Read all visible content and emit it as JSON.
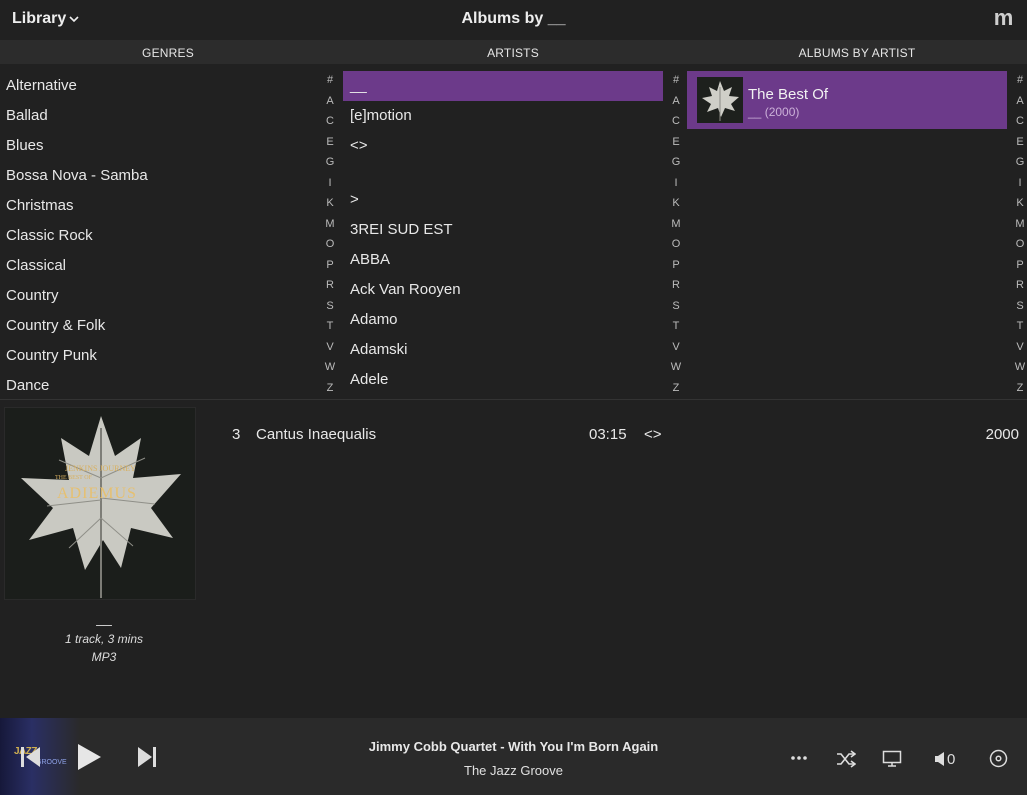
{
  "header": {
    "library_label": "Library",
    "title": "Albums by __"
  },
  "columns": {
    "genres": "GENRES",
    "artists": "ARTISTS",
    "albums": "ALBUMS BY ARTIST"
  },
  "genres": [
    "Alternative",
    "Ballad",
    "Blues",
    "Bossa Nova - Samba",
    "Christmas",
    "Classic Rock",
    "Classical",
    "Country",
    "Country & Folk",
    "Country Punk",
    "Dance"
  ],
  "artists": [
    "__",
    "[e]motion",
    "<>",
    "",
    ">",
    "3REI SUD EST",
    "ABBA",
    "Ack Van Rooyen",
    "Adamo",
    "Adamski",
    "Adele"
  ],
  "az_index": [
    "#",
    "A",
    "C",
    "E",
    "G",
    "I",
    "K",
    "M",
    "O",
    "P",
    "R",
    "S",
    "T",
    "V",
    "W",
    "Z"
  ],
  "album": {
    "title": "The Best Of",
    "artist": "__",
    "year": "(2000)"
  },
  "details": {
    "artist": "__",
    "meta": "1 track, 3 mins",
    "format": "MP3",
    "cover_text": {
      "line1": "JENKINS JOURNEY",
      "line2": "THE BEST OF",
      "line3": "ADIEMUS"
    }
  },
  "track": {
    "number": "3",
    "title": "Cantus Inaequalis",
    "duration": "03:15",
    "artist": "<>",
    "year": "2000"
  },
  "player": {
    "title": "Jimmy Cobb Quartet - With You I'm Born Again",
    "subtitle": "The Jazz Groove",
    "volume": "0",
    "station_logo_top": "JAZZ",
    "station_logo_bottom": "GROOVE"
  },
  "colors": {
    "background": "#212121",
    "header_bar": "#2c2c2c",
    "selection": "#6c3a8a",
    "player_bar": "#2a2a2a"
  }
}
